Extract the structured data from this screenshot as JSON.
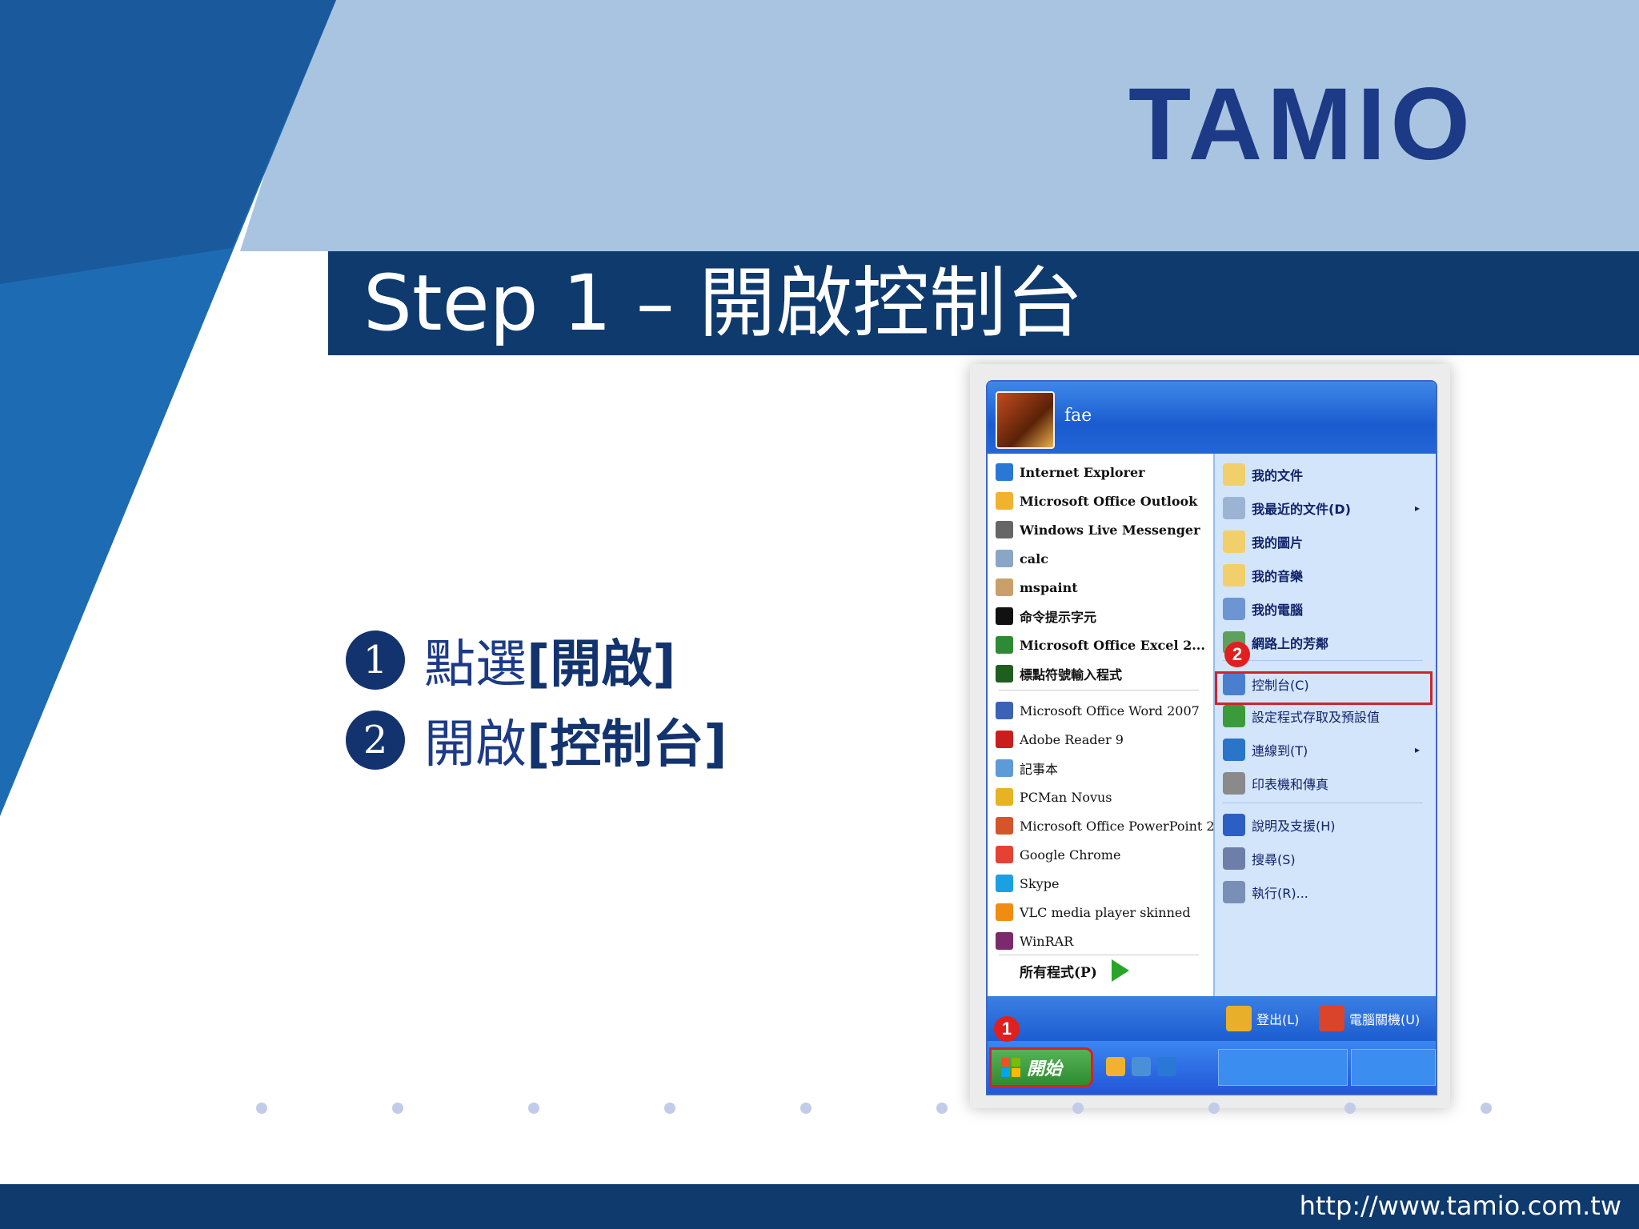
{
  "brand": {
    "logo": "TAMIO"
  },
  "header": {
    "title": "Step 1 – 開啟控制台"
  },
  "steps": [
    {
      "num": "1",
      "text": "點選",
      "bold": "[開啟]"
    },
    {
      "num": "2",
      "text": "開啟",
      "bold": "[控制台]"
    }
  ],
  "start_menu": {
    "user": "fae",
    "left_items": [
      {
        "label": "Internet Explorer",
        "icon": "ie-icon",
        "color": "#2a78d6"
      },
      {
        "label": "Microsoft Office Outlook",
        "icon": "outlook-icon",
        "color": "#f2b230"
      },
      {
        "label": "Windows Live Messenger",
        "icon": "messenger-icon",
        "color": "#666666"
      },
      {
        "label": "calc",
        "icon": "calc-icon",
        "color": "#8aa6c6"
      },
      {
        "label": "mspaint",
        "icon": "paint-icon",
        "color": "#c9a06a"
      },
      {
        "label": "命令提示字元",
        "icon": "cmd-icon",
        "color": "#111111"
      },
      {
        "label": "Microsoft Office Excel 2...",
        "icon": "excel-icon",
        "color": "#2f8a36"
      },
      {
        "label": "標點符號輸入程式",
        "icon": "ime-icon",
        "color": "#1f5e1f"
      },
      {
        "label": "Microsoft Office Word 2007",
        "icon": "word-icon",
        "color": "#3a63b8"
      },
      {
        "label": "Adobe Reader 9",
        "icon": "adobe-icon",
        "color": "#cc1d1d"
      },
      {
        "label": "記事本",
        "icon": "notepad-icon",
        "color": "#5d9bd8"
      },
      {
        "label": "PCMan Novus",
        "icon": "pcman-icon",
        "color": "#e5b323"
      },
      {
        "label": "Microsoft Office PowerPoint 2...",
        "icon": "powerpoint-icon",
        "color": "#d4552b"
      },
      {
        "label": "Google Chrome",
        "icon": "chrome-icon",
        "color": "#e54234"
      },
      {
        "label": "Skype",
        "icon": "skype-icon",
        "color": "#1ba1e2"
      },
      {
        "label": "VLC media player skinned",
        "icon": "vlc-icon",
        "color": "#f08c12"
      },
      {
        "label": "WinRAR",
        "icon": "winrar-icon",
        "color": "#7b2a6b"
      }
    ],
    "all_programs": "所有程式(P)",
    "right_items": [
      {
        "label": "我的文件",
        "icon": "folder-icon",
        "color": "#f1cf6a",
        "bold": true
      },
      {
        "label": "我最近的文件(D)",
        "icon": "recent-docs-icon",
        "color": "#9cb4d4",
        "bold": true,
        "arrow": "▸"
      },
      {
        "label": "我的圖片",
        "icon": "pictures-folder-icon",
        "color": "#f1cf6a",
        "bold": true
      },
      {
        "label": "我的音樂",
        "icon": "music-folder-icon",
        "color": "#f1cf6a",
        "bold": true
      },
      {
        "label": "我的電腦",
        "icon": "computer-icon",
        "color": "#6d95d2",
        "bold": true
      },
      {
        "label": "網路上的芳鄰",
        "icon": "network-icon",
        "color": "#5fa05f",
        "bold": true
      },
      {
        "label": "控制台(C)",
        "icon": "control-panel-icon",
        "color": "#4a7fd0",
        "bold": false
      },
      {
        "label": "設定程式存取及預設值",
        "icon": "defaults-icon",
        "color": "#3b9b3b",
        "bold": false
      },
      {
        "label": "連線到(T)",
        "icon": "connect-icon",
        "color": "#2a74c9",
        "bold": false,
        "arrow": "▸"
      },
      {
        "label": "印表機和傳真",
        "icon": "printer-icon",
        "color": "#8a8a8a",
        "bold": false
      },
      {
        "label": "說明及支援(H)",
        "icon": "help-icon",
        "color": "#2b5fc4",
        "bold": false
      },
      {
        "label": "搜尋(S)",
        "icon": "search-icon",
        "color": "#6d7fa8",
        "bold": false
      },
      {
        "label": "執行(R)...",
        "icon": "run-icon",
        "color": "#7a8fb5",
        "bold": false
      }
    ],
    "logoff": "登出(L)",
    "shutdown": "電腦關機(U)",
    "start_button": "開始",
    "markers": [
      "1",
      "2"
    ]
  },
  "footer": {
    "url": "http://www.tamio.com.tw"
  }
}
